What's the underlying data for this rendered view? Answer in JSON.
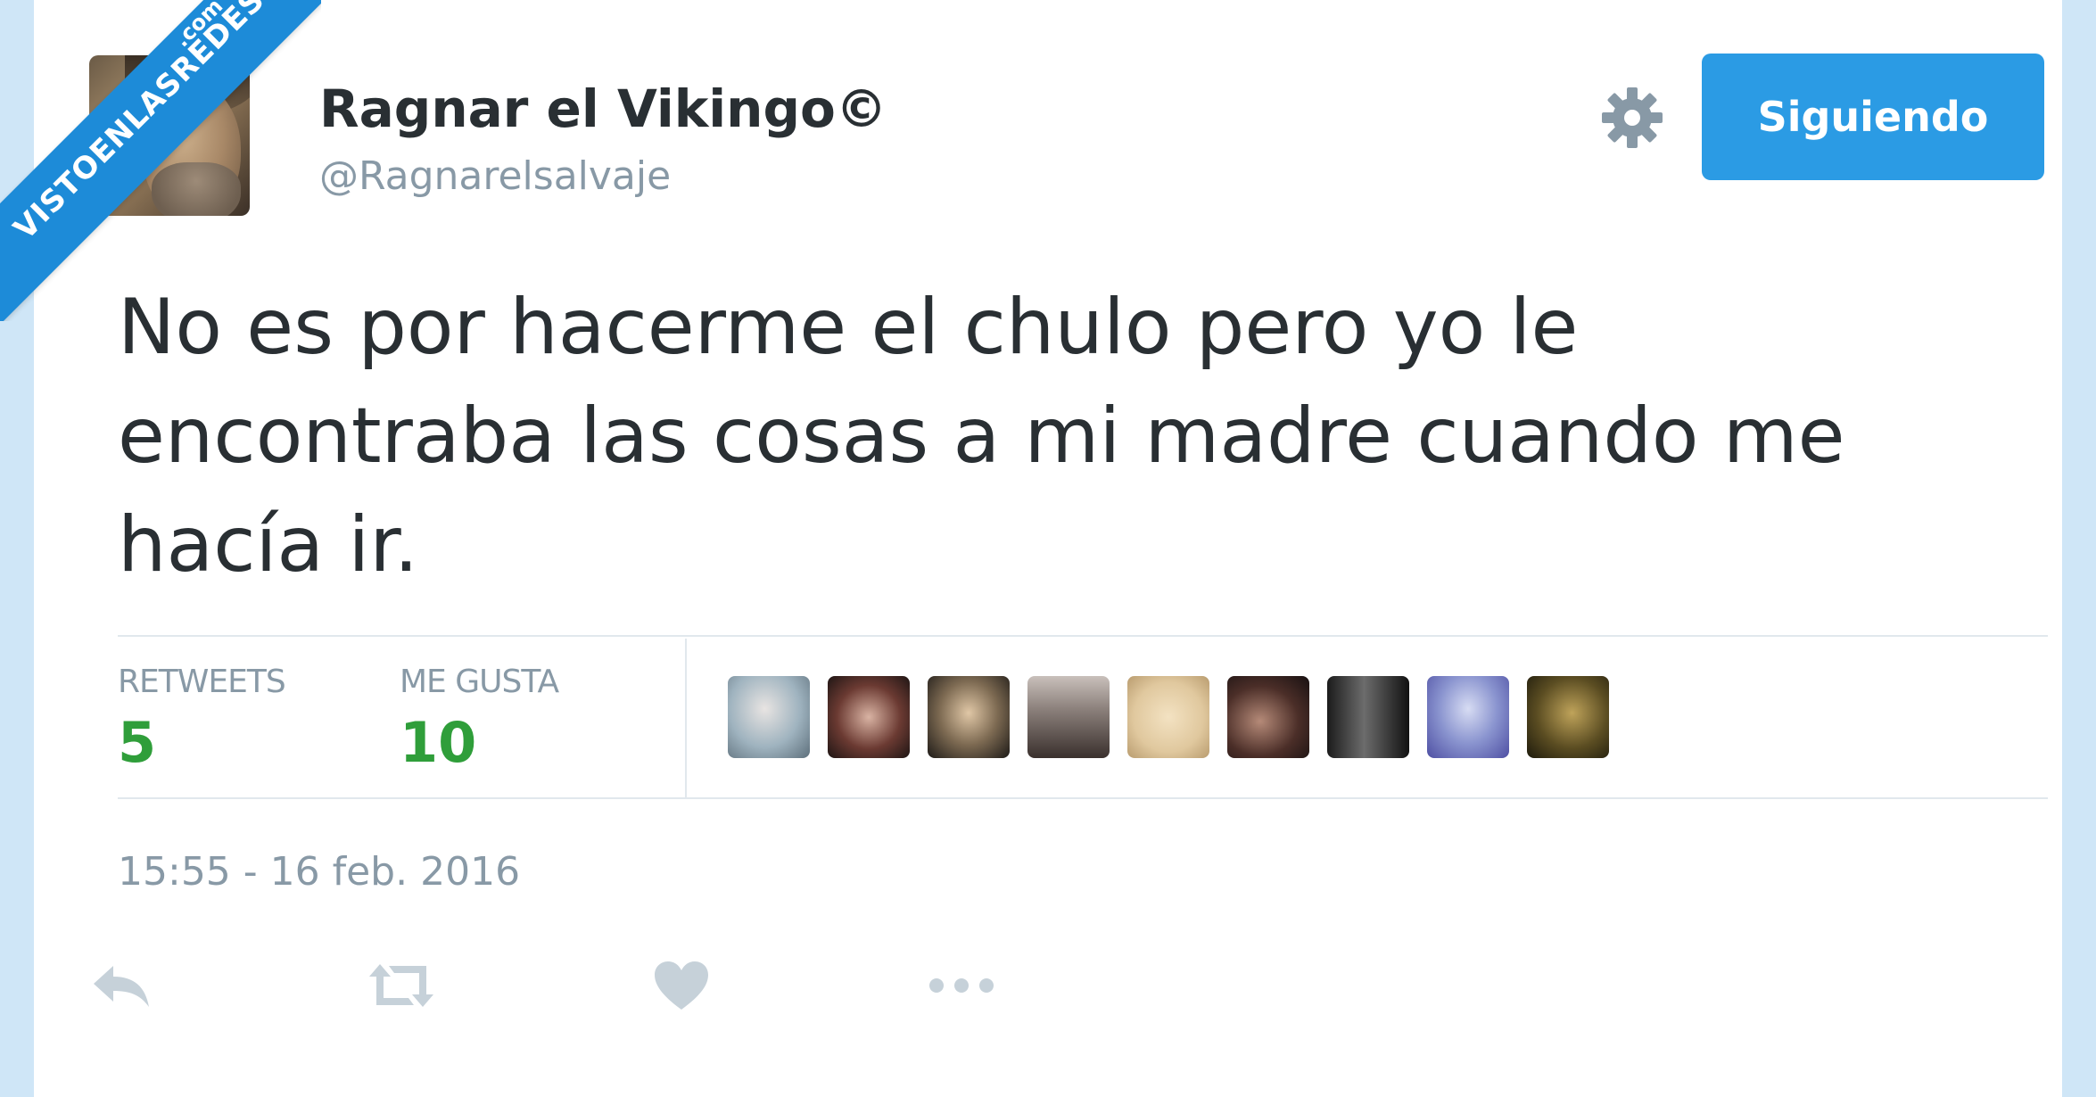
{
  "watermark": {
    "main": "VISTOENLASREDES",
    "sub": ".com"
  },
  "author": {
    "name": "Ragnar el Vikingo©",
    "handle": "@Ragnarelsalvaje"
  },
  "follow_button": {
    "label": "Siguiendo"
  },
  "tweet": {
    "lines": [
      "No es por hacerme el chulo pero yo le",
      "encontraba las cosas a mi madre cuando me",
      "hacía ir."
    ]
  },
  "stats": {
    "retweets_label": "RETWEETS",
    "retweets_value": "5",
    "likes_label": "ME GUSTA",
    "likes_value": "10"
  },
  "timestamp": "15:55 - 16 feb. 2016",
  "colors": {
    "accent": "#2b9be4",
    "stat_value": "#2f9e3a",
    "muted": "#8899a6",
    "text": "#292f33"
  },
  "icons": {
    "settings": "gear-icon",
    "reply": "reply-icon",
    "retweet": "retweet-icon",
    "like": "heart-icon",
    "more": "more-icon"
  }
}
